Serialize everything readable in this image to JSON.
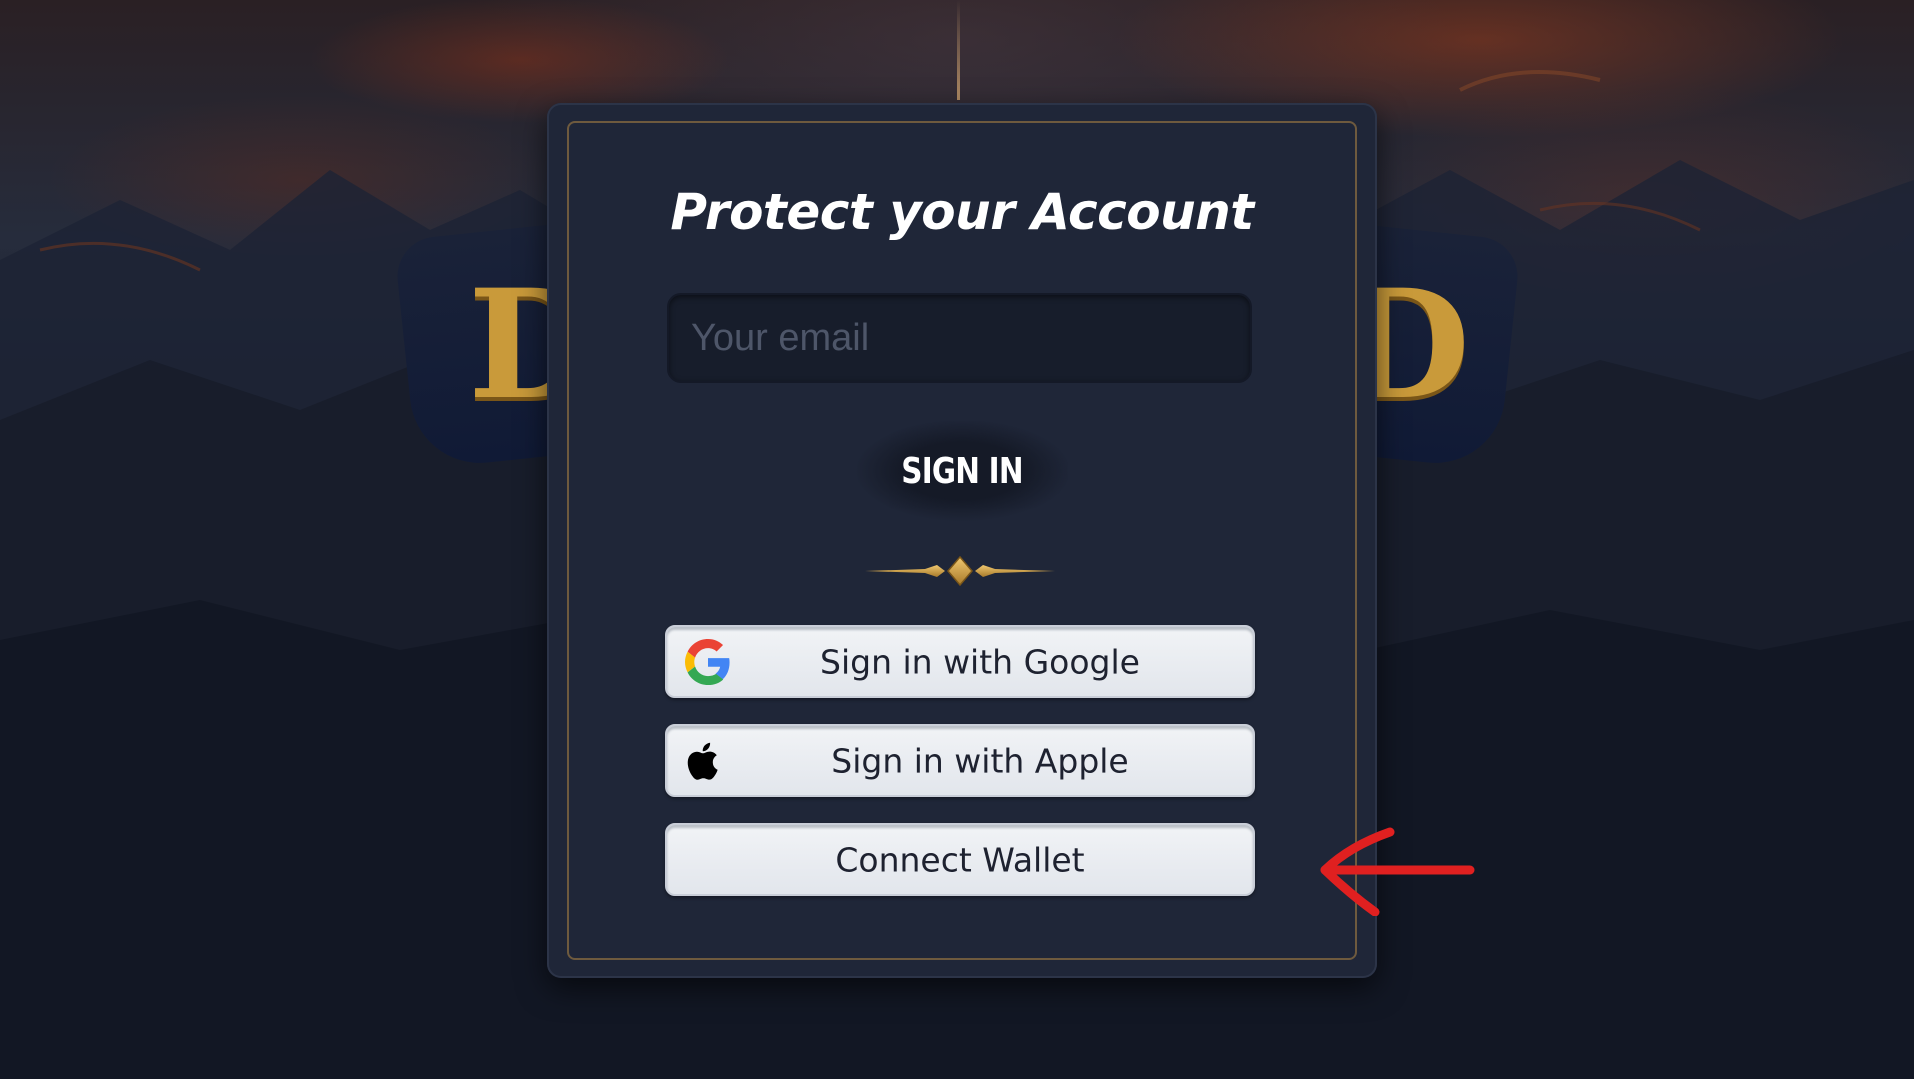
{
  "dialog": {
    "title": "Protect your Account",
    "email": {
      "value": "",
      "placeholder": "Your email"
    },
    "sign_in_label": "SIGN IN",
    "buttons": {
      "google": "Sign in with Google",
      "apple": "Sign in with Apple",
      "wallet": "Connect Wallet"
    }
  },
  "icons": {
    "google": "google-icon",
    "apple": "apple-icon",
    "ornament": "gold-divider-ornament",
    "annotation": "red-arrow-icon"
  },
  "colors": {
    "dialog_bg": "#1f2638",
    "frame_gold": "#6e5a3e",
    "button_bg": "#e8ebf0",
    "annotation_red": "#e02020",
    "logo_gold": "#c99a3a"
  }
}
